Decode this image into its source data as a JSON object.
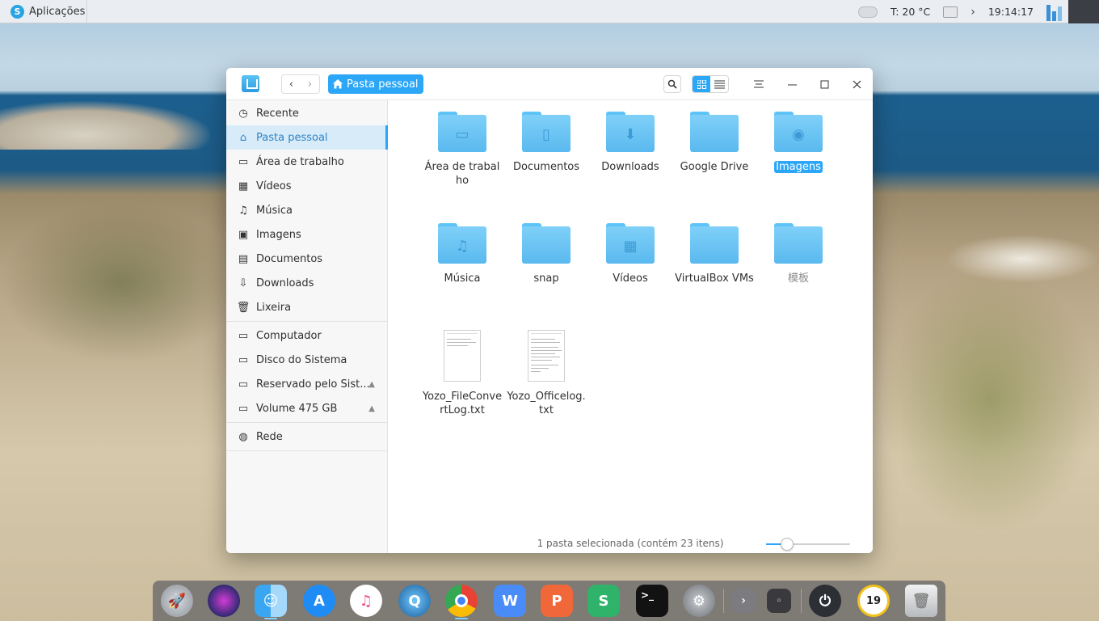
{
  "taskbar": {
    "apps_label": "Aplicações",
    "temperature": "T: 20 °C",
    "clock": "19:14:17"
  },
  "window": {
    "breadcrumb": "Pasta pessoal",
    "sidebar": {
      "items": [
        {
          "label": "Recente",
          "icon": "clock-icon"
        },
        {
          "label": "Pasta pessoal",
          "icon": "home-icon",
          "active": true
        },
        {
          "label": "Área de trabalho",
          "icon": "desktop-icon"
        },
        {
          "label": "Vídeos",
          "icon": "film-icon"
        },
        {
          "label": "Música",
          "icon": "music-icon"
        },
        {
          "label": "Imagens",
          "icon": "image-icon"
        },
        {
          "label": "Documentos",
          "icon": "document-icon"
        },
        {
          "label": "Downloads",
          "icon": "download-icon"
        },
        {
          "label": "Lixeira",
          "icon": "trash-icon"
        }
      ],
      "devices": [
        {
          "label": "Computador",
          "icon": "computer-icon"
        },
        {
          "label": "Disco do Sistema",
          "icon": "disk-icon"
        },
        {
          "label": "Reservado pelo Sist...",
          "icon": "disk-icon",
          "eject": true
        },
        {
          "label": "Volume 475 GB",
          "icon": "disk-icon",
          "eject": true
        }
      ],
      "network": [
        {
          "label": "Rede",
          "icon": "network-icon"
        }
      ]
    },
    "files": [
      {
        "name": "Área de trabalho",
        "type": "folder",
        "glyph": "desktop"
      },
      {
        "name": "Documentos",
        "type": "folder",
        "glyph": "document"
      },
      {
        "name": "Downloads",
        "type": "folder",
        "glyph": "download"
      },
      {
        "name": "Google Drive",
        "type": "folder",
        "glyph": ""
      },
      {
        "name": "Imagens",
        "type": "folder",
        "glyph": "camera",
        "selected": true
      },
      {
        "name": "Música",
        "type": "folder",
        "glyph": "music"
      },
      {
        "name": "snap",
        "type": "folder",
        "glyph": ""
      },
      {
        "name": "Vídeos",
        "type": "folder",
        "glyph": "film"
      },
      {
        "name": "VirtualBox VMs",
        "type": "folder",
        "glyph": ""
      },
      {
        "name": "模板",
        "type": "folder",
        "glyph": "",
        "muted": true
      },
      {
        "name": "Yozo_FileConvertLog.txt",
        "type": "text"
      },
      {
        "name": "Yozo_Officelog.txt",
        "type": "text"
      }
    ],
    "status_text": "1 pasta selecionada (contém 23 itens)",
    "zoom_level": 0.25
  },
  "dock": {
    "apps": [
      "launcher",
      "siri",
      "finder",
      "app-store",
      "itunes",
      "quicktime",
      "chrome",
      "wps-writer",
      "wps-presentation",
      "wps-spreadsheet",
      "terminal",
      "system-settings",
      "expand",
      "tray",
      "power",
      "clock",
      "trash"
    ]
  }
}
